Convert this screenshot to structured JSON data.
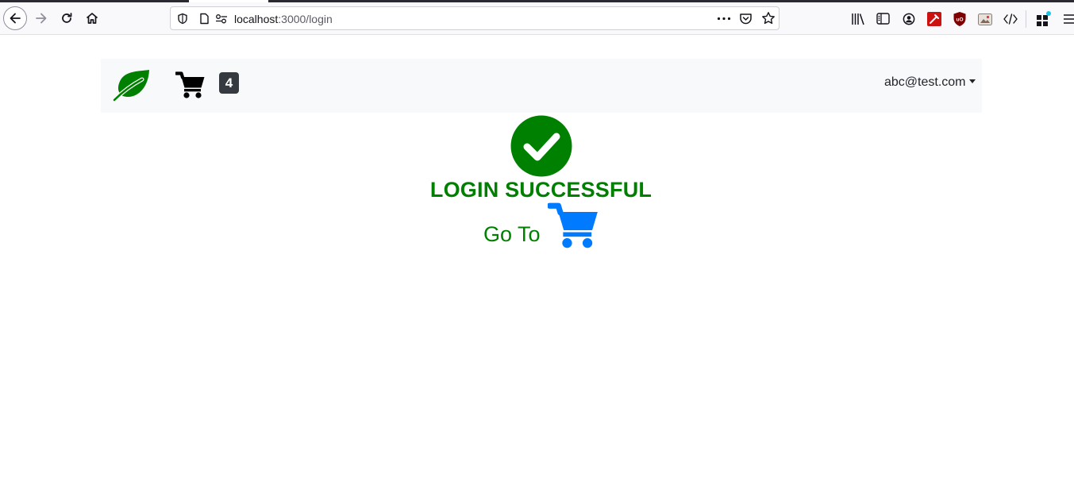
{
  "browser": {
    "url_host": "localhost",
    "url_path": ":3000/login"
  },
  "navbar": {
    "cart_count": "4",
    "user_email": "abc@test.com"
  },
  "main": {
    "title": "LOGIN SUCCESSFUL",
    "goto_label": "Go To"
  },
  "icons": {
    "logo": "leaf-icon",
    "cart": "cart-icon",
    "success": "check-circle-icon",
    "goto_cart": "cart-icon"
  },
  "colors": {
    "success_green": "#008000",
    "link_blue": "#007bff",
    "navbar_bg": "#f8f9fa",
    "badge_bg": "#343a40"
  }
}
